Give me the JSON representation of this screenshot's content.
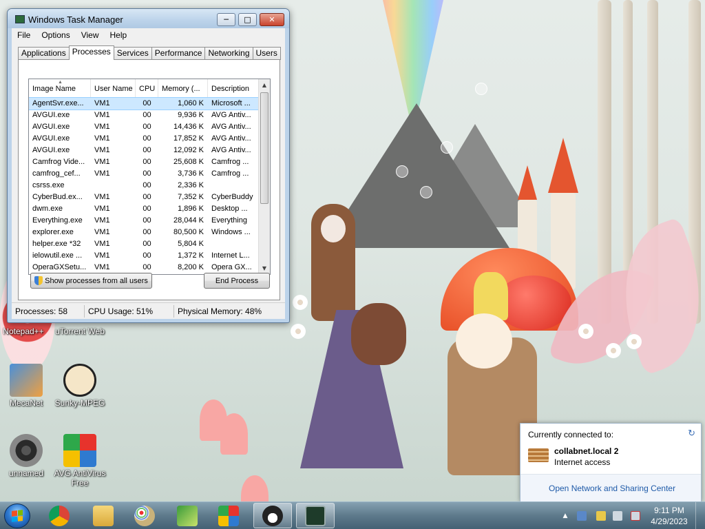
{
  "task_manager": {
    "title": "Windows Task Manager",
    "menu": [
      "File",
      "Options",
      "View",
      "Help"
    ],
    "tabs": [
      "Applications",
      "Processes",
      "Services",
      "Performance",
      "Networking",
      "Users"
    ],
    "active_tab": "Processes",
    "columns": [
      "Image Name",
      "User Name",
      "CPU",
      "Memory (...",
      "Description"
    ],
    "processes": [
      {
        "name": "AgentSvr.exe...",
        "user": "VM1",
        "cpu": "00",
        "memory": "1,060 K",
        "description": "Microsoft ..."
      },
      {
        "name": "AVGUI.exe",
        "user": "VM1",
        "cpu": "00",
        "memory": "9,936 K",
        "description": "AVG Antiv..."
      },
      {
        "name": "AVGUI.exe",
        "user": "VM1",
        "cpu": "00",
        "memory": "14,436 K",
        "description": "AVG Antiv..."
      },
      {
        "name": "AVGUI.exe",
        "user": "VM1",
        "cpu": "00",
        "memory": "17,852 K",
        "description": "AVG Antiv..."
      },
      {
        "name": "AVGUI.exe",
        "user": "VM1",
        "cpu": "00",
        "memory": "12,092 K",
        "description": "AVG Antiv..."
      },
      {
        "name": "Camfrog Vide...",
        "user": "VM1",
        "cpu": "00",
        "memory": "25,608 K",
        "description": "Camfrog ..."
      },
      {
        "name": "camfrog_cef...",
        "user": "VM1",
        "cpu": "00",
        "memory": "3,736 K",
        "description": "Camfrog ..."
      },
      {
        "name": "csrss.exe",
        "user": "",
        "cpu": "00",
        "memory": "2,336 K",
        "description": ""
      },
      {
        "name": "CyberBud.ex...",
        "user": "VM1",
        "cpu": "00",
        "memory": "7,352 K",
        "description": "CyberBuddy"
      },
      {
        "name": "dwm.exe",
        "user": "VM1",
        "cpu": "00",
        "memory": "1,896 K",
        "description": "Desktop ..."
      },
      {
        "name": "Everything.exe",
        "user": "VM1",
        "cpu": "00",
        "memory": "28,044 K",
        "description": "Everything"
      },
      {
        "name": "explorer.exe",
        "user": "VM1",
        "cpu": "00",
        "memory": "80,500 K",
        "description": "Windows ..."
      },
      {
        "name": "helper.exe *32",
        "user": "VM1",
        "cpu": "00",
        "memory": "5,804 K",
        "description": ""
      },
      {
        "name": "ielowutil.exe ...",
        "user": "VM1",
        "cpu": "00",
        "memory": "1,372 K",
        "description": "Internet L..."
      },
      {
        "name": "OperaGXSetu...",
        "user": "VM1",
        "cpu": "00",
        "memory": "8,200 K",
        "description": "Opera GX..."
      }
    ],
    "show_all_label": "Show processes from all users",
    "end_process_label": "End Process",
    "status": {
      "processes": "Processes: 58",
      "cpu": "CPU Usage: 51%",
      "memory": "Physical Memory: 48%"
    }
  },
  "desktop_icons": [
    {
      "label": "Notepad++",
      "icon": "notepad-plus-plus-icon"
    },
    {
      "label": "uTorrent Web",
      "icon": "utorrent-icon"
    },
    {
      "label": "MecaNet",
      "icon": "mecanet-icon"
    },
    {
      "label": "Sunky-MPEG",
      "icon": "sunky-mpeg-icon"
    },
    {
      "label": "unnamed",
      "icon": "fidget-spinner-icon"
    },
    {
      "label": "AVG AntiVirus Free",
      "icon": "avg-antivirus-icon"
    }
  ],
  "network_popup": {
    "heading": "Currently connected to:",
    "network_name": "collabnet.local  2",
    "access": "Internet access",
    "link": "Open Network and Sharing Center"
  },
  "taskbar": {
    "pinned": [
      "chrome-icon",
      "file-explorer-icon",
      "paint-icon",
      "plant-app-icon",
      "avg-icon",
      "penguin-app-icon",
      "task-manager-icon"
    ],
    "time": "9:11 PM",
    "date": "4/29/2023"
  },
  "colors": {
    "selection": "#cde8ff",
    "link": "#1e5aa8",
    "close_button": "#c9432d"
  }
}
